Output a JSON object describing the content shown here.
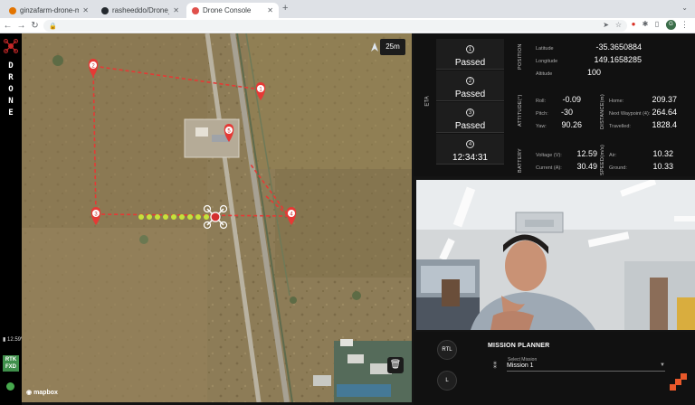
{
  "browser": {
    "tabs": [
      {
        "title": "ginzafarm-drone-mission",
        "favicon_color": "#e37400"
      },
      {
        "title": "rasheeddo/Drone_webrtc",
        "favicon_color": "#24292e"
      },
      {
        "title": "Drone Console",
        "favicon_color": "#e0504b"
      }
    ],
    "new_tab": "+",
    "url": "",
    "avatar_letter": "G"
  },
  "sidebar": {
    "brand_letters": [
      "D",
      "R",
      "O",
      "N",
      "E"
    ],
    "battery": "12.59V",
    "rtk_line1": "RTK",
    "rtk_line2": "FXD",
    "accent": "#3f8f4b"
  },
  "map": {
    "zoom_badge": "25m",
    "attribution": "mapbox",
    "waypoints": [
      "1",
      "2",
      "3",
      "4",
      "5"
    ],
    "trash_icon": "trash-icon"
  },
  "telemetry": {
    "eta_label": "ETA",
    "eta": [
      {
        "num": "1",
        "status": "Passed"
      },
      {
        "num": "2",
        "status": "Passed"
      },
      {
        "num": "3",
        "status": "Passed"
      },
      {
        "num": "4",
        "status": "12:34:31"
      }
    ],
    "position": {
      "label": "POSITION",
      "latitude_label": "Latitude",
      "latitude": "-35.3650884",
      "longitude_label": "Longitude",
      "longitude": "149.1658285",
      "altitude_label": "Altitude",
      "altitude": "100"
    },
    "attitude": {
      "label": "ATTITUDE(°)",
      "roll_label": "Roll:",
      "roll": "-0.09",
      "pitch_label": "Pitch:",
      "pitch": "-30",
      "yaw_label": "Yaw:",
      "yaw": "90.26"
    },
    "distance": {
      "label": "DISTANCE(m)",
      "home_label": "Home:",
      "home": "209.37",
      "next_label": "Next Waypoint (4):",
      "next": "264.64",
      "travelled_label": "Travelled:",
      "travelled": "1828.4"
    },
    "battery": {
      "label": "BATTERY",
      "voltage_label": "Voltage (V):",
      "voltage": "12.59",
      "current_label": "Current (A):",
      "current": "30.49"
    },
    "speed": {
      "label": "SPEED(m/s)",
      "air_label": "Air:",
      "air": "10.32",
      "ground_label": "Ground:",
      "ground": "10.33"
    }
  },
  "planner": {
    "rtl_label": "RTL",
    "l_label": "L",
    "title": "MISSION PLANNER",
    "select_label": "Select Mission",
    "selected_mission": "Mission 1"
  }
}
